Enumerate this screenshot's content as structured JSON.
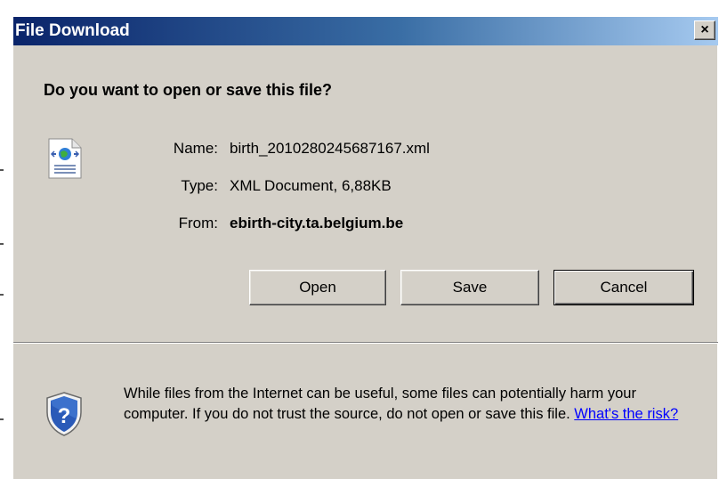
{
  "window": {
    "title": "File Download",
    "close_label": "×"
  },
  "dialog": {
    "question": "Do you want to open or save this file?",
    "file": {
      "name_label": "Name:",
      "name_value": "birth_2010280245687167.xml",
      "type_label": "Type:",
      "type_value": "XML Document, 6,88KB",
      "from_label": "From:",
      "from_value": "ebirth-city.ta.belgium.be"
    },
    "buttons": {
      "open": "Open",
      "save": "Save",
      "cancel": "Cancel"
    },
    "warning": {
      "text": "While files from the Internet can be useful, some files can potentially harm your computer. If you do not trust the source, do not open or save this file.",
      "link": "What's the risk?"
    }
  },
  "icons": {
    "file": "xml-file-icon",
    "shield": "security-shield-icon"
  },
  "colors": {
    "title_start": "#0a246a",
    "title_end": "#a6caf0",
    "face": "#d4d0c8",
    "link": "#0000ff"
  }
}
